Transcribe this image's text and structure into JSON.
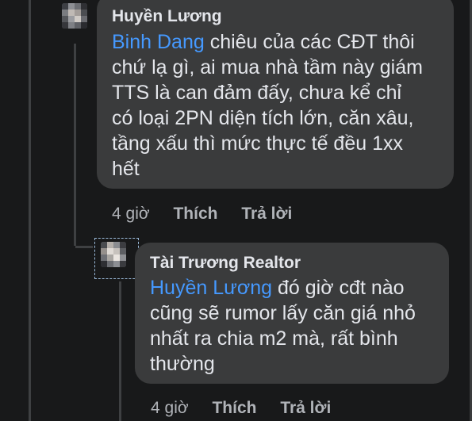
{
  "comments": [
    {
      "author": "Huyền Lương",
      "mention": "Binh Dang",
      "text_lines": [
        " chiêu của các CĐT thôi",
        "chứ lạ gì, ai mua nhà tầm này giám",
        "TTS là can đảm đấy, chưa kể chỉ",
        "có loại 2PN diện tích lớn, căn xâu,",
        "tầng xấu thì mức thực tế đều 1xx",
        "hết"
      ],
      "time": "4 giờ",
      "like_label": "Thích",
      "reply_label": "Trả lời"
    },
    {
      "author": "Tài Trương Realtor",
      "mention": "Huyền Lương",
      "text_lines": [
        " đó giờ cđt nào",
        "cũng sẽ rumor lấy căn giá nhỏ",
        "nhất ra chia m2 mà, rất bình",
        "thường"
      ],
      "time": "4 giờ",
      "like_label": "Thích",
      "reply_label": "Trả lời"
    }
  ],
  "colors": {
    "background": "#18191a",
    "bubble": "#3a3b3c",
    "mention": "#4599ff",
    "meta": "#b0b3b8"
  },
  "icons": [
    "avatar-image",
    "avatar-image"
  ]
}
